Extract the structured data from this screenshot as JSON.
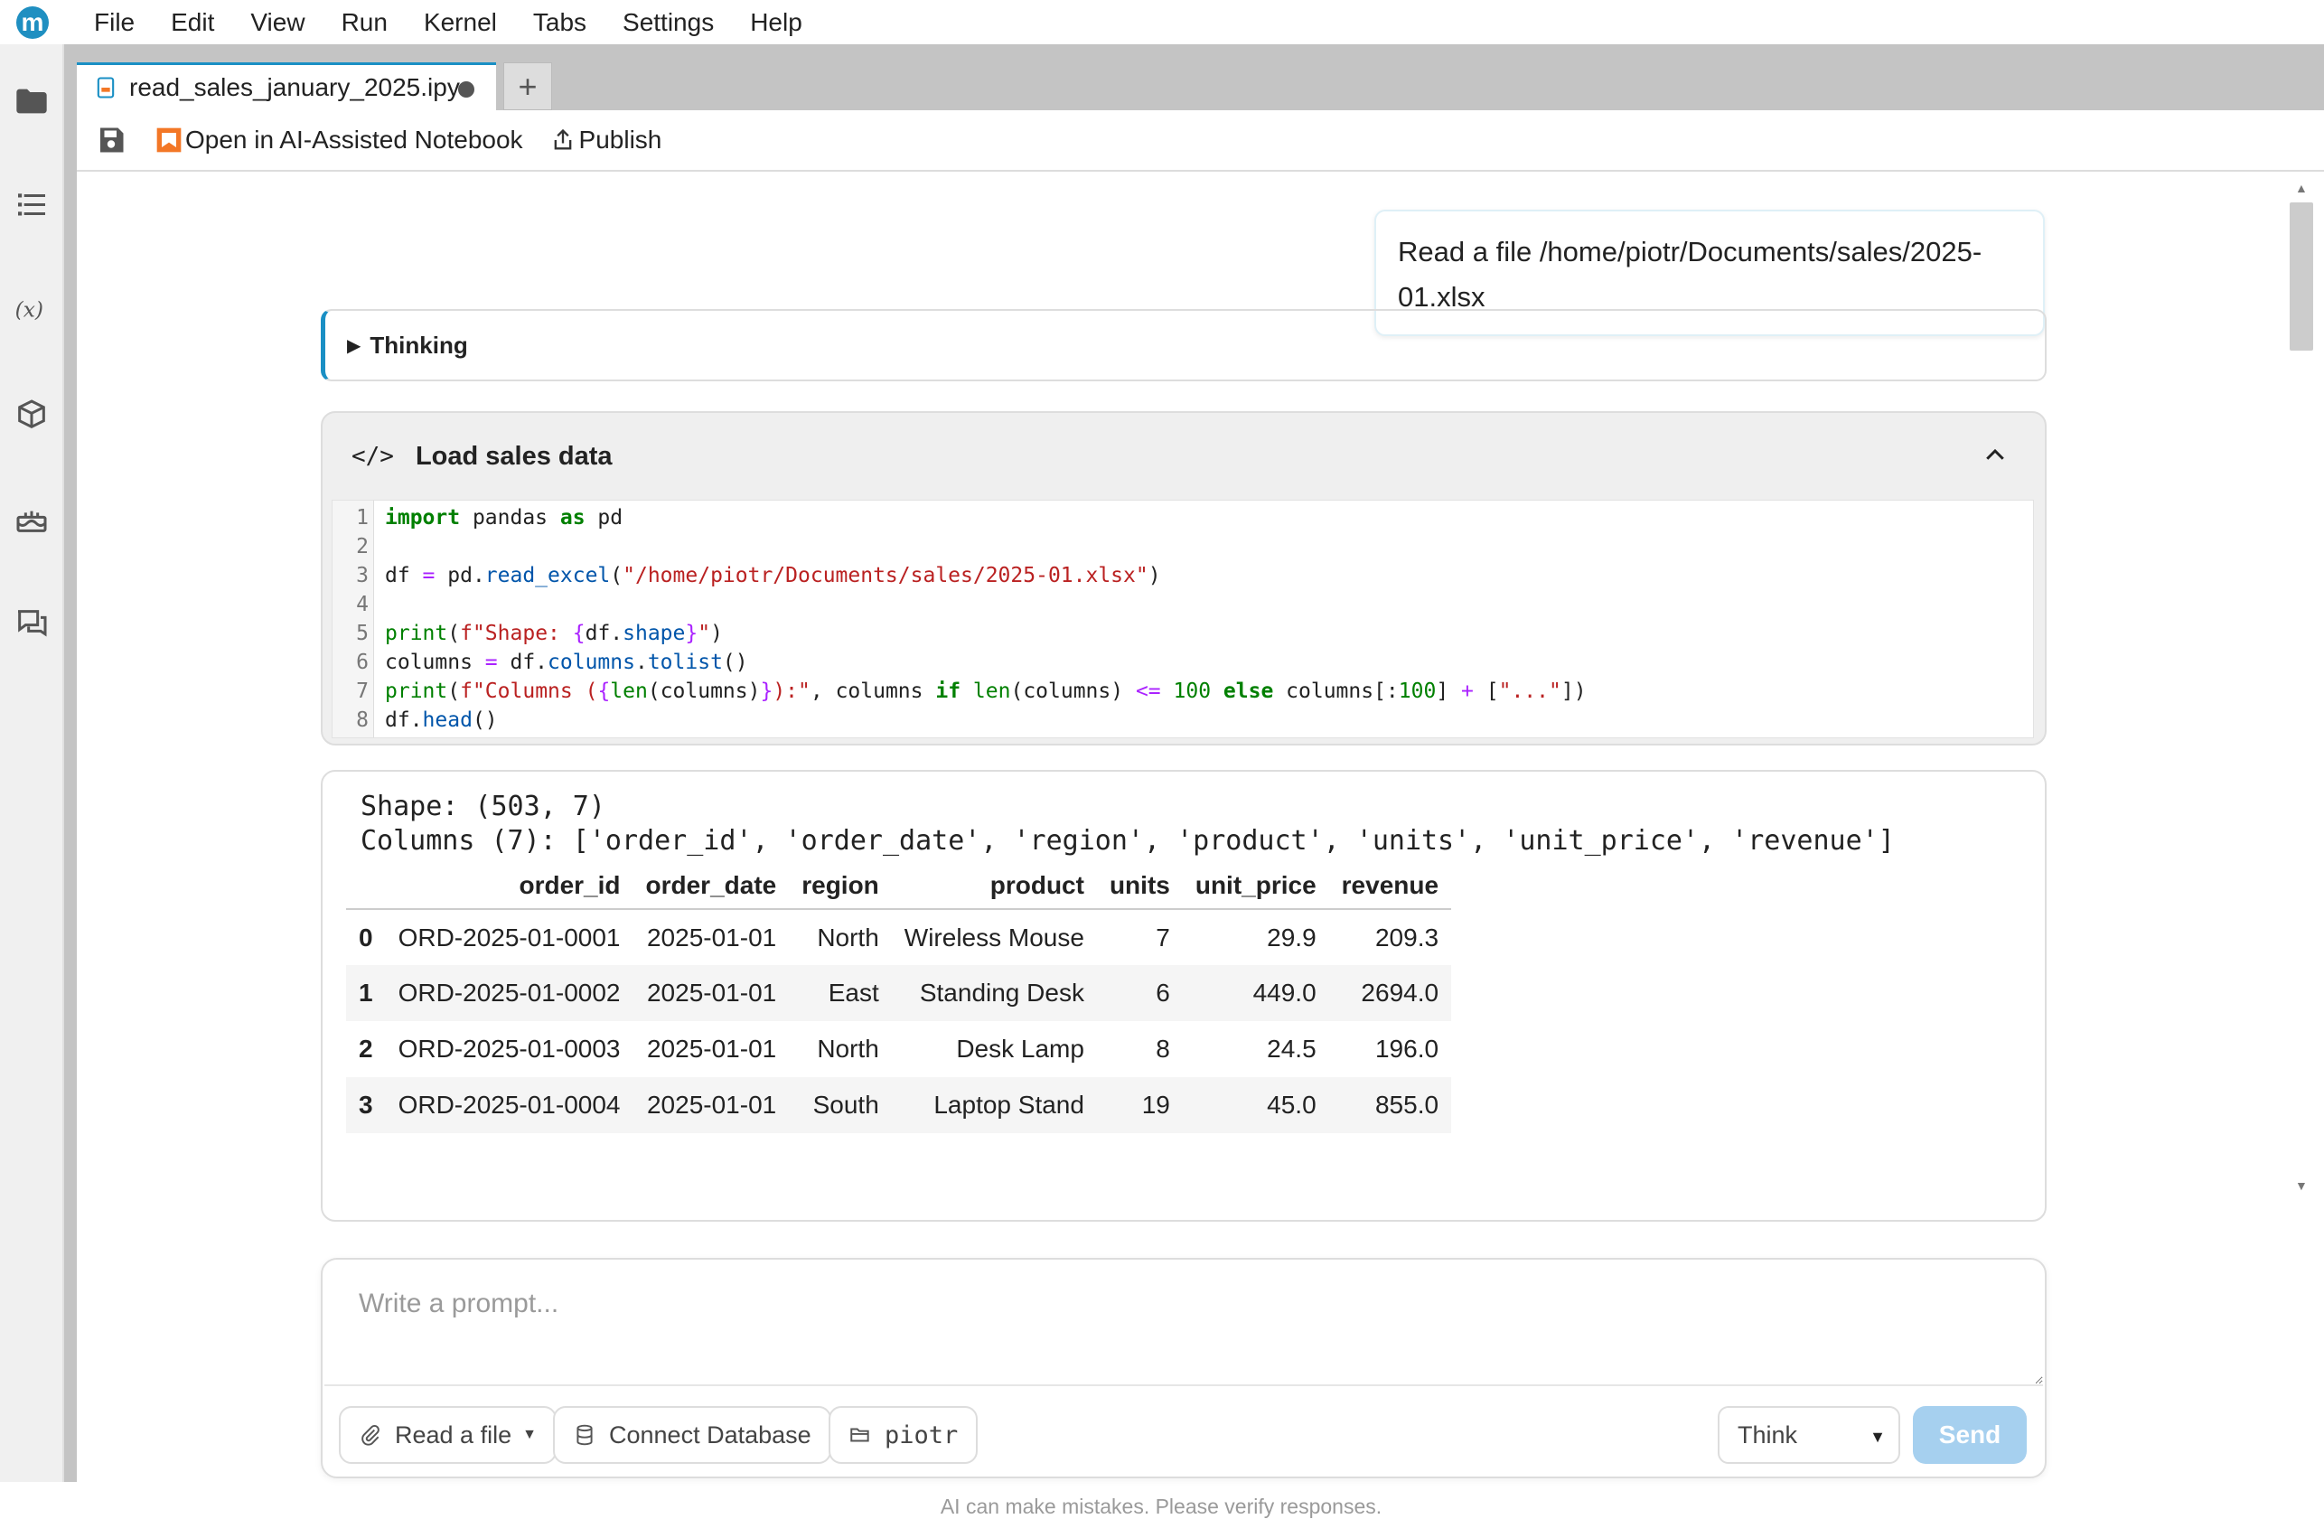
{
  "app": {
    "logo_letter": "m"
  },
  "menu": [
    "File",
    "Edit",
    "View",
    "Run",
    "Kernel",
    "Tabs",
    "Settings",
    "Help"
  ],
  "sidebar_icons": [
    "folder-icon",
    "list-icon",
    "variables-icon",
    "package-icon",
    "cake-icon",
    "chat-icon"
  ],
  "tab": {
    "label": "read_sales_january_2025.ipy",
    "add_label": "+"
  },
  "toolbar": {
    "open_ai_label": "Open in AI-Assisted Notebook",
    "publish_label": "Publish"
  },
  "user_message": "Read a file /home/piotr/Documents/sales/2025-01.xlsx",
  "thinking": {
    "label": "Thinking"
  },
  "code_cell": {
    "tag": "</>",
    "title": "Load sales data",
    "line_numbers": [
      "1",
      "2",
      "3",
      "4",
      "5",
      "6",
      "7",
      "8"
    ]
  },
  "output": {
    "shape_line": "Shape: (503, 7)",
    "columns_line": "Columns (7): ['order_id', 'order_date', 'region', 'product', 'units', 'unit_price', 'revenue']",
    "headers": [
      "",
      "order_id",
      "order_date",
      "region",
      "product",
      "units",
      "unit_price",
      "revenue"
    ],
    "rows": [
      [
        "0",
        "ORD-2025-01-0001",
        "2025-01-01",
        "North",
        "Wireless Mouse",
        "7",
        "29.9",
        "209.3"
      ],
      [
        "1",
        "ORD-2025-01-0002",
        "2025-01-01",
        "East",
        "Standing Desk",
        "6",
        "449.0",
        "2694.0"
      ],
      [
        "2",
        "ORD-2025-01-0003",
        "2025-01-01",
        "North",
        "Desk Lamp",
        "8",
        "24.5",
        "196.0"
      ],
      [
        "3",
        "ORD-2025-01-0004",
        "2025-01-01",
        "South",
        "Laptop Stand",
        "19",
        "45.0",
        "855.0"
      ]
    ]
  },
  "prompt": {
    "placeholder": "Write a prompt...",
    "read_file_label": "Read a file",
    "connect_db_label": "Connect Database",
    "folder_label": "piotr",
    "mode_label": "Think",
    "send_label": "Send"
  },
  "disclaimer": "AI can make mistakes. Please verify responses.",
  "colors": {
    "accent": "#1a8fc4",
    "send_disabled": "#a6d0ef"
  }
}
